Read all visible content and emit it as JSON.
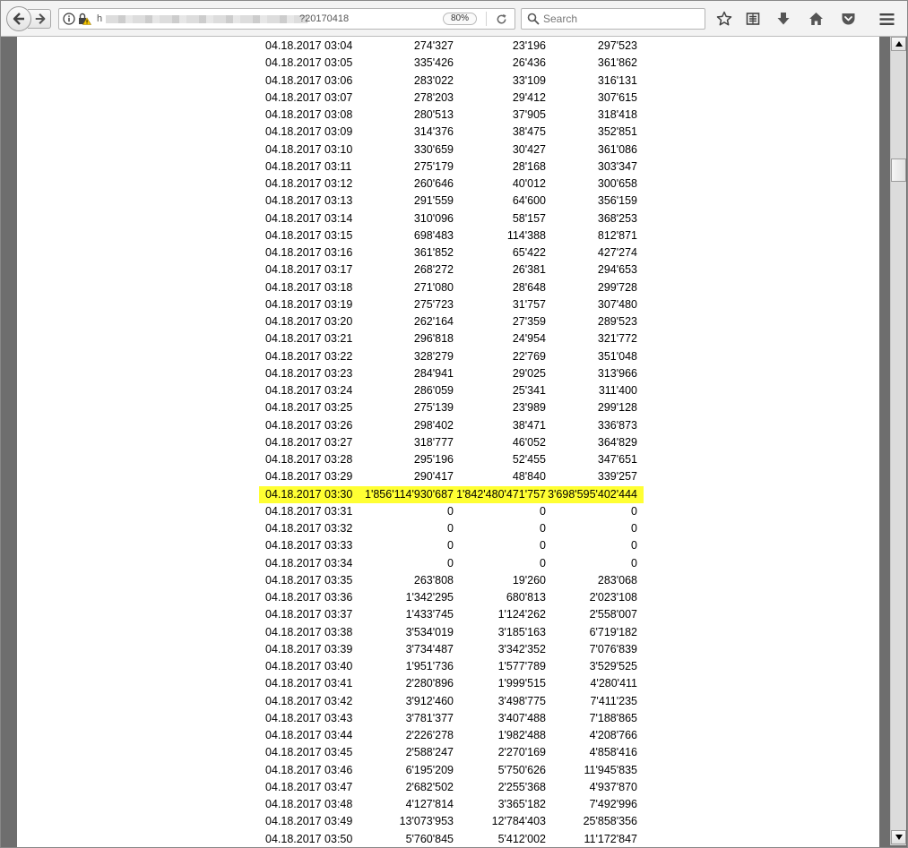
{
  "browser": {
    "url_prefix": "h",
    "url_suffix": "?20170418",
    "zoom": "80%",
    "search_placeholder": "Search"
  },
  "icons": {
    "back": "back-arrow-icon",
    "forward": "forward-arrow-icon",
    "info": "info-icon",
    "lock": "lock-warning-icon",
    "reload": "reload-icon",
    "search": "search-icon",
    "bookmark": "star-icon",
    "library": "reading-list-icon",
    "download": "download-icon",
    "home": "home-icon",
    "pocket": "pocket-icon",
    "menu": "hamburger-menu-icon"
  },
  "colors": {
    "highlight": "#ffff33",
    "gutter": "#6e6e6e"
  },
  "table": {
    "highlight_index": 26,
    "rows": [
      [
        "04.18.2017 03:04",
        "274'327",
        "23'196",
        "297'523"
      ],
      [
        "04.18.2017 03:05",
        "335'426",
        "26'436",
        "361'862"
      ],
      [
        "04.18.2017 03:06",
        "283'022",
        "33'109",
        "316'131"
      ],
      [
        "04.18.2017 03:07",
        "278'203",
        "29'412",
        "307'615"
      ],
      [
        "04.18.2017 03:08",
        "280'513",
        "37'905",
        "318'418"
      ],
      [
        "04.18.2017 03:09",
        "314'376",
        "38'475",
        "352'851"
      ],
      [
        "04.18.2017 03:10",
        "330'659",
        "30'427",
        "361'086"
      ],
      [
        "04.18.2017 03:11",
        "275'179",
        "28'168",
        "303'347"
      ],
      [
        "04.18.2017 03:12",
        "260'646",
        "40'012",
        "300'658"
      ],
      [
        "04.18.2017 03:13",
        "291'559",
        "64'600",
        "356'159"
      ],
      [
        "04.18.2017 03:14",
        "310'096",
        "58'157",
        "368'253"
      ],
      [
        "04.18.2017 03:15",
        "698'483",
        "114'388",
        "812'871"
      ],
      [
        "04.18.2017 03:16",
        "361'852",
        "65'422",
        "427'274"
      ],
      [
        "04.18.2017 03:17",
        "268'272",
        "26'381",
        "294'653"
      ],
      [
        "04.18.2017 03:18",
        "271'080",
        "28'648",
        "299'728"
      ],
      [
        "04.18.2017 03:19",
        "275'723",
        "31'757",
        "307'480"
      ],
      [
        "04.18.2017 03:20",
        "262'164",
        "27'359",
        "289'523"
      ],
      [
        "04.18.2017 03:21",
        "296'818",
        "24'954",
        "321'772"
      ],
      [
        "04.18.2017 03:22",
        "328'279",
        "22'769",
        "351'048"
      ],
      [
        "04.18.2017 03:23",
        "284'941",
        "29'025",
        "313'966"
      ],
      [
        "04.18.2017 03:24",
        "286'059",
        "25'341",
        "311'400"
      ],
      [
        "04.18.2017 03:25",
        "275'139",
        "23'989",
        "299'128"
      ],
      [
        "04.18.2017 03:26",
        "298'402",
        "38'471",
        "336'873"
      ],
      [
        "04.18.2017 03:27",
        "318'777",
        "46'052",
        "364'829"
      ],
      [
        "04.18.2017 03:28",
        "295'196",
        "52'455",
        "347'651"
      ],
      [
        "04.18.2017 03:29",
        "290'417",
        "48'840",
        "339'257"
      ],
      [
        "04.18.2017 03:30",
        "1'856'114'930'687",
        "1'842'480'471'757",
        "3'698'595'402'444"
      ],
      [
        "04.18.2017 03:31",
        "0",
        "0",
        "0"
      ],
      [
        "04.18.2017 03:32",
        "0",
        "0",
        "0"
      ],
      [
        "04.18.2017 03:33",
        "0",
        "0",
        "0"
      ],
      [
        "04.18.2017 03:34",
        "0",
        "0",
        "0"
      ],
      [
        "04.18.2017 03:35",
        "263'808",
        "19'260",
        "283'068"
      ],
      [
        "04.18.2017 03:36",
        "1'342'295",
        "680'813",
        "2'023'108"
      ],
      [
        "04.18.2017 03:37",
        "1'433'745",
        "1'124'262",
        "2'558'007"
      ],
      [
        "04.18.2017 03:38",
        "3'534'019",
        "3'185'163",
        "6'719'182"
      ],
      [
        "04.18.2017 03:39",
        "3'734'487",
        "3'342'352",
        "7'076'839"
      ],
      [
        "04.18.2017 03:40",
        "1'951'736",
        "1'577'789",
        "3'529'525"
      ],
      [
        "04.18.2017 03:41",
        "2'280'896",
        "1'999'515",
        "4'280'411"
      ],
      [
        "04.18.2017 03:42",
        "3'912'460",
        "3'498'775",
        "7'411'235"
      ],
      [
        "04.18.2017 03:43",
        "3'781'377",
        "3'407'488",
        "7'188'865"
      ],
      [
        "04.18.2017 03:44",
        "2'226'278",
        "1'982'488",
        "4'208'766"
      ],
      [
        "04.18.2017 03:45",
        "2'588'247",
        "2'270'169",
        "4'858'416"
      ],
      [
        "04.18.2017 03:46",
        "6'195'209",
        "5'750'626",
        "11'945'835"
      ],
      [
        "04.18.2017 03:47",
        "2'682'502",
        "2'255'368",
        "4'937'870"
      ],
      [
        "04.18.2017 03:48",
        "4'127'814",
        "3'365'182",
        "7'492'996"
      ],
      [
        "04.18.2017 03:49",
        "13'073'953",
        "12'784'403",
        "25'858'356"
      ],
      [
        "04.18.2017 03:50",
        "5'760'845",
        "5'412'002",
        "11'172'847"
      ]
    ]
  }
}
